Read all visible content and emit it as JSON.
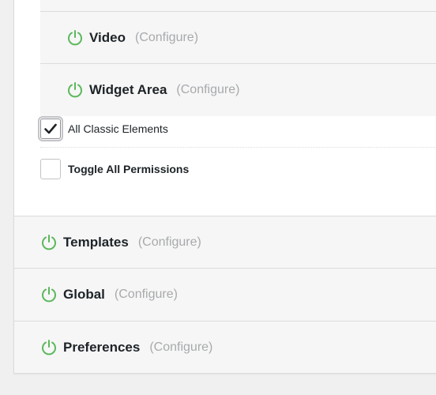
{
  "sub_items": [
    {
      "title": "Video",
      "configure": "(Configure)"
    },
    {
      "title": "Widget Area",
      "configure": "(Configure)"
    }
  ],
  "checkboxes": [
    {
      "label": "All Classic Elements",
      "checked": true
    },
    {
      "label": "Toggle All Permissions",
      "checked": false
    }
  ],
  "main_items": [
    {
      "title": "Templates",
      "configure": "(Configure)"
    },
    {
      "title": "Global",
      "configure": "(Configure)"
    },
    {
      "title": "Preferences",
      "configure": "(Configure)"
    }
  ],
  "colors": {
    "power_icon": "#5cb85c",
    "configure_text": "#a7aaad",
    "row_bg": "#f6f6f6"
  },
  "icons": {
    "power": "power-icon",
    "check": "checkmark-icon"
  }
}
